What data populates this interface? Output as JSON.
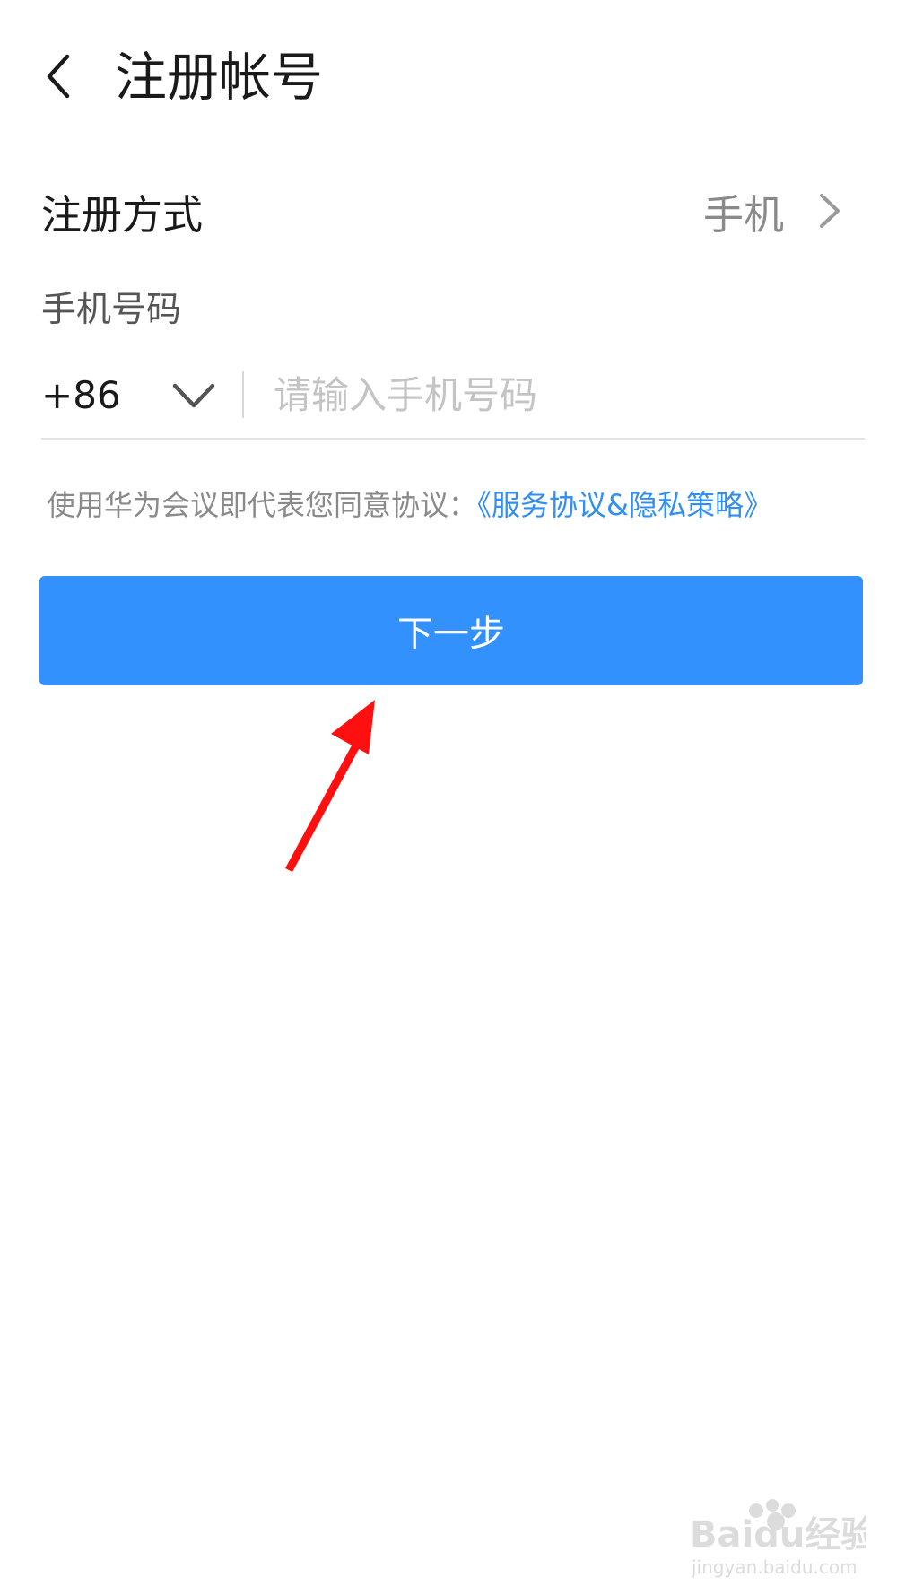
{
  "header": {
    "title": "注册帐号",
    "back_icon": "chevron-left-icon"
  },
  "method": {
    "label": "注册方式",
    "value": "手机",
    "icon": "chevron-right-icon"
  },
  "phone": {
    "label": "手机号码",
    "country_code": "+86",
    "placeholder": "请输入手机号码",
    "value": ""
  },
  "agreement": {
    "text": "使用华为会议即代表您同意协议：",
    "link": "《服务协议&隐私策略》"
  },
  "next_button": {
    "label": "下一步"
  },
  "colors": {
    "accent": "#3291fd",
    "link": "#2f8ff4",
    "annotation_arrow": "#ff1010"
  },
  "watermark": {
    "brand": "Baidu经验",
    "url": "jingyan.baidu.com"
  }
}
